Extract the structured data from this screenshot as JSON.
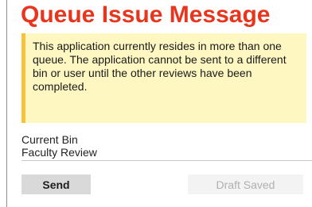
{
  "dialog": {
    "title": "Queue Issue Message",
    "warning": {
      "message": "This application currently resides in more than one queue. The application cannot be sent to a different bin or user until the other reviews have been completed."
    },
    "current_bin": {
      "label": "Current Bin",
      "value": "Faculty Review"
    },
    "actions": {
      "send_label": "Send",
      "draft_status": "Draft Saved"
    }
  },
  "colors": {
    "title": "#e8351e",
    "warning_background": "#fff7c2",
    "warning_border": "#f6c33b",
    "send_button_background": "#d9d9d9",
    "draft_status_background": "#f3f3f3",
    "draft_status_text": "#b0b0b0"
  }
}
